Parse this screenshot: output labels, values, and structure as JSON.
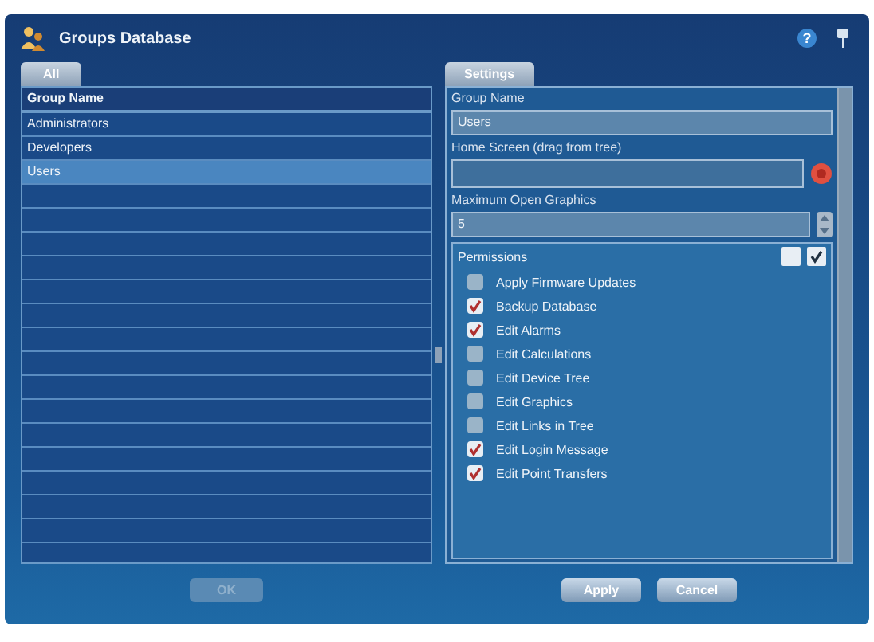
{
  "window": {
    "title": "Groups Database",
    "help": "?"
  },
  "left_tabs": [
    {
      "label": "All",
      "selected": true
    }
  ],
  "groups_list": {
    "header": "Group Name",
    "rows": [
      {
        "name": "Administrators",
        "selected": false
      },
      {
        "name": "Developers",
        "selected": false
      },
      {
        "name": "Users",
        "selected": true
      }
    ]
  },
  "ok_button": {
    "label": "OK",
    "disabled": true
  },
  "right_tabs": [
    {
      "label": "Settings",
      "selected": true
    }
  ],
  "settings": {
    "group_name_label": "Group Name",
    "group_name_value": "Users",
    "home_screen_label": "Home Screen (drag from tree)",
    "max_graphics_label": "Maximum Open Graphics",
    "max_graphics_value": "5",
    "permissions_label": "Permissions",
    "permissions": [
      {
        "label": "Apply Firmware Updates",
        "checked": false
      },
      {
        "label": "Backup Database",
        "checked": true
      },
      {
        "label": "Edit Alarms",
        "checked": true
      },
      {
        "label": "Edit Calculations",
        "checked": false
      },
      {
        "label": "Edit Device Tree",
        "checked": false
      },
      {
        "label": "Edit Graphics",
        "checked": false
      },
      {
        "label": "Edit Links in Tree",
        "checked": false
      },
      {
        "label": "Edit Login Message",
        "checked": true
      },
      {
        "label": "Edit Point Transfers",
        "checked": true
      }
    ]
  },
  "buttons": [
    {
      "label": "Apply"
    },
    {
      "label": "Cancel"
    }
  ]
}
